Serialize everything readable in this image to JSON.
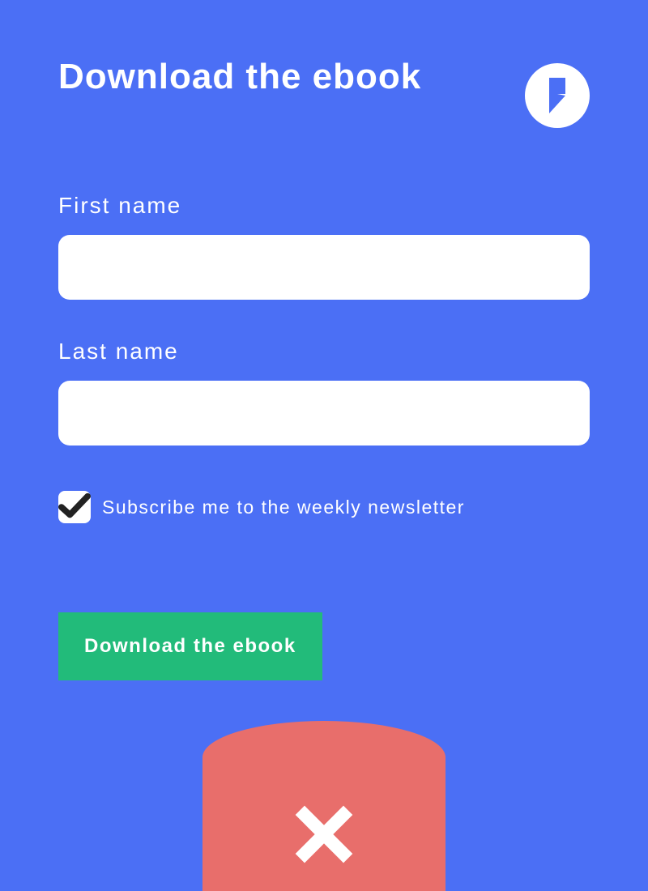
{
  "header": {
    "title": "Download the ebook"
  },
  "form": {
    "first_name": {
      "label": "First name",
      "value": ""
    },
    "last_name": {
      "label": "Last name",
      "value": ""
    },
    "newsletter": {
      "label": "Subscribe me to the weekly newsletter",
      "checked": true
    },
    "submit_label": "Download the ebook"
  },
  "icons": {
    "logo": "bolt-icon",
    "checkmark": "check-icon",
    "close": "close-icon"
  },
  "colors": {
    "background": "#4b6ff5",
    "accent": "#22bb7a",
    "badge": "#e86e6b",
    "text": "#ffffff"
  }
}
